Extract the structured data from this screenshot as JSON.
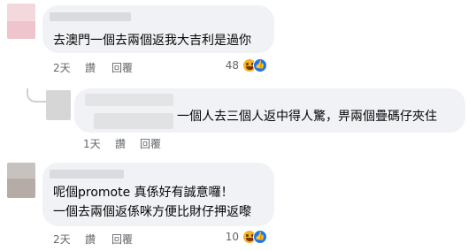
{
  "comments": [
    {
      "text": "去澳門一個去兩個返我大吉利是過你",
      "time": "2天",
      "like_label": "讚",
      "reply_label": "回覆",
      "reaction_count": "48"
    },
    {
      "text": "一個人去三個人返中得人驚，畀兩個疊碼仔夾住",
      "time": "1天",
      "like_label": "讚",
      "reply_label": "回覆"
    },
    {
      "text_line1": "呢個promote 真係好有誠意囉！",
      "text_line2": "一個去兩個返係咪方便比財仔押返嚟",
      "time": "2天",
      "like_label": "讚",
      "reply_label": "回覆",
      "reaction_count": "10"
    }
  ],
  "reactions": {
    "haha": "haha-icon",
    "like": "like-icon"
  },
  "colors": {
    "bubble": "#f0f2f5",
    "meta": "#65676b",
    "like_blue": "#1877f2"
  }
}
